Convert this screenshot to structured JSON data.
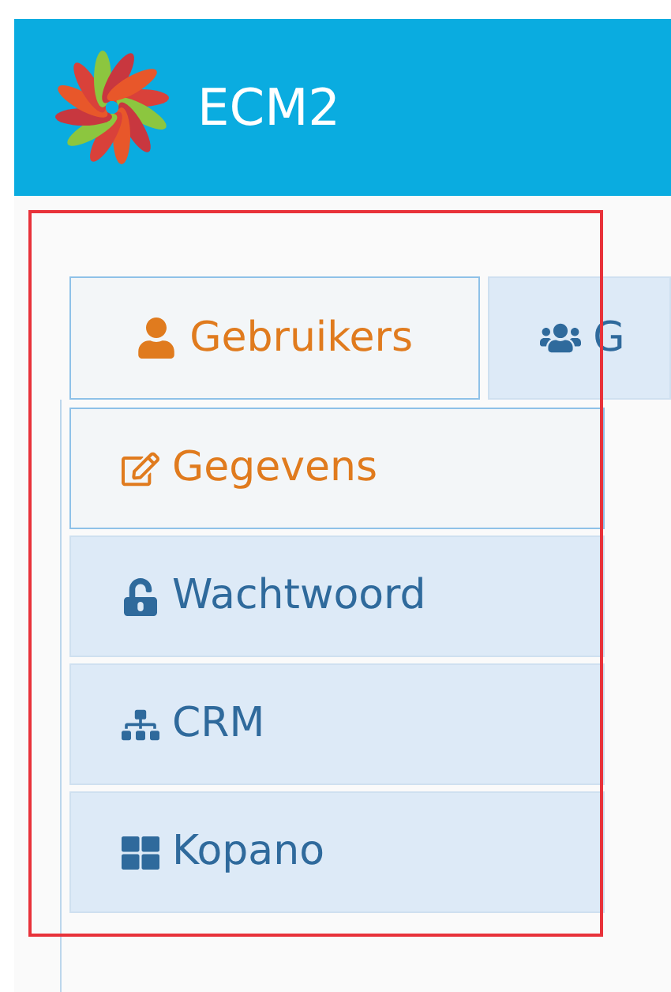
{
  "header": {
    "title": "ECM2"
  },
  "tabs": [
    {
      "label": "Gebruikers",
      "selected": true
    },
    {
      "label": "G",
      "selected": false
    }
  ],
  "menu": [
    {
      "label": "Gegevens",
      "selected": true
    },
    {
      "label": "Wachtwoord",
      "selected": false
    },
    {
      "label": "CRM",
      "selected": false
    },
    {
      "label": "Kopano",
      "selected": false
    }
  ]
}
